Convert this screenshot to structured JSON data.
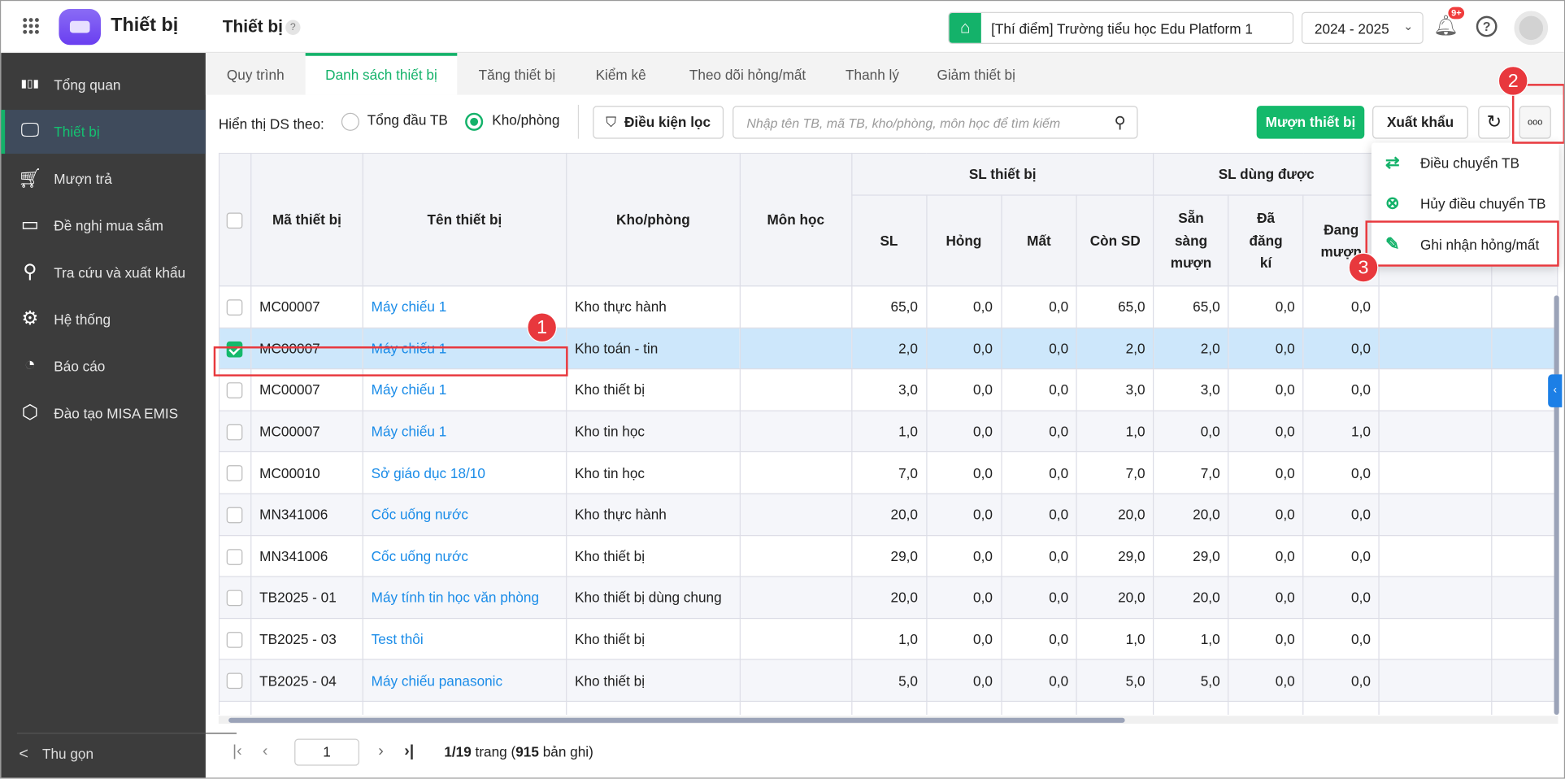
{
  "header": {
    "app_title": "Thiết bị",
    "page_title": "Thiết bị",
    "help_mark": "?",
    "school": "[Thí điểm] Trường tiểu học Edu Platform 1",
    "year": "2024 - 2025",
    "notif_badge": "9+",
    "help_label": "?"
  },
  "sidebar": {
    "items": [
      {
        "label": "Tổng quan",
        "icon": "bar-chart-icon"
      },
      {
        "label": "Thiết bị",
        "icon": "monitor-icon",
        "active": true
      },
      {
        "label": "Mượn trả",
        "icon": "cart-icon"
      },
      {
        "label": "Đề nghị mua sắm",
        "icon": "projector-icon"
      },
      {
        "label": "Tra cứu và xuất khẩu",
        "icon": "search-icon"
      },
      {
        "label": "Hệ thống",
        "icon": "gear-icon"
      },
      {
        "label": "Báo cáo",
        "icon": "pie-chart-icon"
      },
      {
        "label": "Đào tạo MISA EMIS",
        "icon": "cube-icon"
      }
    ],
    "collapse": "Thu gọn"
  },
  "tabs": [
    "Quy trình",
    "Danh sách thiết bị",
    "Tăng thiết bị",
    "Kiểm kê",
    "Theo dõi hỏng/mất",
    "Thanh lý",
    "Giảm thiết bị"
  ],
  "active_tab": "Danh sách thiết bị",
  "toolbar": {
    "view_label": "Hiển thị DS theo:",
    "radio_total": "Tổng đầu TB",
    "radio_room": "Kho/phòng",
    "radio_selected": "Kho/phòng",
    "filter": "Điều kiện lọc",
    "search_placeholder": "Nhập tên TB, mã TB, kho/phòng, môn học để tìm kiếm",
    "borrow": "Mượn thiết bị",
    "export": "Xuất khẩu",
    "more": "ooo"
  },
  "menu": {
    "items": [
      "Điều chuyển TB",
      "Hủy điều chuyển TB",
      "Ghi nhận hỏng/mất"
    ]
  },
  "annotations": {
    "one": "1",
    "two": "2",
    "three": "3"
  },
  "table": {
    "group_headers": {
      "sl_thiet_bi": "SL thiết bị",
      "sl_dung_duoc": "SL dùng được"
    },
    "headers": {
      "code": "Mã thiết bị",
      "name": "Tên thiết bị",
      "room": "Kho/phòng",
      "subject": "Môn học",
      "sl": "SL",
      "hong": "Hỏng",
      "mat": "Mất",
      "con_sd": "Còn SD",
      "san_sang": "Sẵn sàng mượn",
      "da_dang_ki": "Đã đăng kí",
      "dang_muon": "Đang mượn"
    },
    "rows": [
      {
        "checked": false,
        "code": "MC00007",
        "name": "Máy chiếu 1",
        "room": "Kho thực hành",
        "subject": "",
        "sl": "65,0",
        "hong": "0,0",
        "mat": "0,0",
        "con_sd": "65,0",
        "san_sang": "65,0",
        "da_dang_ki": "0,0",
        "dang_muon": "0,0"
      },
      {
        "checked": true,
        "code": "MC00007",
        "name": "Máy chiếu 1",
        "room": "Kho toán - tin",
        "subject": "",
        "sl": "2,0",
        "hong": "0,0",
        "mat": "0,0",
        "con_sd": "2,0",
        "san_sang": "2,0",
        "da_dang_ki": "0,0",
        "dang_muon": "0,0"
      },
      {
        "checked": false,
        "code": "MC00007",
        "name": "Máy chiếu 1",
        "room": "Kho thiết bị",
        "subject": "",
        "sl": "3,0",
        "hong": "0,0",
        "mat": "0,0",
        "con_sd": "3,0",
        "san_sang": "3,0",
        "da_dang_ki": "0,0",
        "dang_muon": "0,0"
      },
      {
        "checked": false,
        "code": "MC00007",
        "name": "Máy chiếu 1",
        "room": "Kho tin học",
        "subject": "",
        "sl": "1,0",
        "hong": "0,0",
        "mat": "0,0",
        "con_sd": "1,0",
        "san_sang": "0,0",
        "da_dang_ki": "0,0",
        "dang_muon": "1,0"
      },
      {
        "checked": false,
        "code": "MC00010",
        "name": "Sở giáo dục 18/10",
        "room": "Kho tin học",
        "subject": "",
        "sl": "7,0",
        "hong": "0,0",
        "mat": "0,0",
        "con_sd": "7,0",
        "san_sang": "7,0",
        "da_dang_ki": "0,0",
        "dang_muon": "0,0"
      },
      {
        "checked": false,
        "code": "MN341006",
        "name": "Cốc uống nước",
        "room": "Kho thực hành",
        "subject": "",
        "sl": "20,0",
        "hong": "0,0",
        "mat": "0,0",
        "con_sd": "20,0",
        "san_sang": "20,0",
        "da_dang_ki": "0,0",
        "dang_muon": "0,0"
      },
      {
        "checked": false,
        "code": "MN341006",
        "name": "Cốc uống nước",
        "room": "Kho thiết bị",
        "subject": "",
        "sl": "29,0",
        "hong": "0,0",
        "mat": "0,0",
        "con_sd": "29,0",
        "san_sang": "29,0",
        "da_dang_ki": "0,0",
        "dang_muon": "0,0"
      },
      {
        "checked": false,
        "code": "TB2025 - 01",
        "name": "Máy tính tin học văn phòng",
        "room": "Kho thiết bị dùng chung",
        "subject": "",
        "sl": "20,0",
        "hong": "0,0",
        "mat": "0,0",
        "con_sd": "20,0",
        "san_sang": "20,0",
        "da_dang_ki": "0,0",
        "dang_muon": "0,0"
      },
      {
        "checked": false,
        "code": "TB2025 - 03",
        "name": "Test thôi",
        "room": "Kho thiết bị",
        "subject": "",
        "sl": "1,0",
        "hong": "0,0",
        "mat": "0,0",
        "con_sd": "1,0",
        "san_sang": "1,0",
        "da_dang_ki": "0,0",
        "dang_muon": "0,0"
      },
      {
        "checked": false,
        "code": "TB2025 - 04",
        "name": "Máy chiếu panasonic",
        "room": "Kho thiết bị",
        "subject": "",
        "sl": "5,0",
        "hong": "0,0",
        "mat": "0,0",
        "con_sd": "5,0",
        "san_sang": "5,0",
        "da_dang_ki": "0,0",
        "dang_muon": "0,0"
      }
    ]
  },
  "pagination": {
    "page": "1",
    "page_info_bold": "1/19",
    "page_word": " trang (",
    "records": "915",
    "records_word": " bản ghi)"
  },
  "colors": {
    "accent": "#14b96b",
    "link": "#1a8ce8",
    "selected_row": "#cde7fb",
    "annotation": "#e8383d",
    "sidebar": "#3c3c3c"
  }
}
